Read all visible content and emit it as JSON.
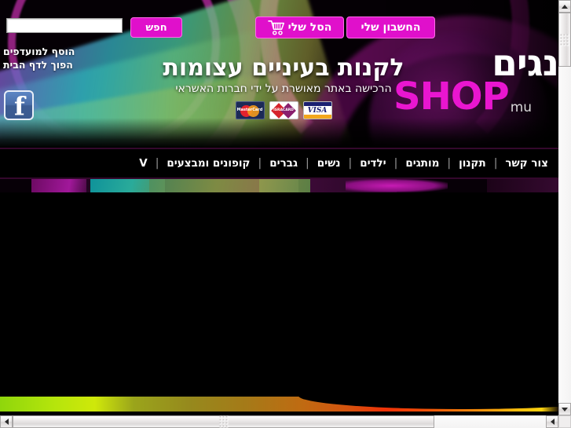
{
  "topbar": {
    "search_value": "",
    "search_placeholder": "",
    "search_button": "חפש",
    "cart_button": "הסל שלי",
    "account_button": "החשבון שלי",
    "cart_icon": "shopping-cart-icon"
  },
  "side_links": [
    {
      "label": "הוסף למועדפים"
    },
    {
      "label": "הפוך לדף הבית"
    }
  ],
  "social": {
    "facebook_glyph": "f",
    "facebook_icon": "facebook-icon"
  },
  "banner": {
    "headline": "לקנות בעיניים עצומות",
    "subline": "הרכישה באתר מאושרת על ידי חברות האשראי",
    "cards": [
      {
        "name": "mastercard-logo",
        "label": "MasterCard"
      },
      {
        "name": "isracard-logo",
        "label": "ISRACARD"
      },
      {
        "name": "visa-logo",
        "label": "VISA"
      }
    ]
  },
  "logo": {
    "top_text": "נגים",
    "shop_text": "SHOP",
    "suffix_text": "mu"
  },
  "nav": {
    "items": [
      {
        "label": "צור קשר"
      },
      {
        "label": "תקנון"
      },
      {
        "label": "מותגים"
      },
      {
        "label": "ילדים"
      },
      {
        "label": "נשים"
      },
      {
        "label": "גברים"
      },
      {
        "label": "קופונים ומבצעים"
      },
      {
        "label": "V"
      }
    ],
    "separator": "|"
  },
  "colors": {
    "accent_magenta": "#e010cb",
    "accent_magenta_border": "#ff6ae8",
    "logo_shop": "#e916d0",
    "nav_background": "#000000",
    "nav_border": "#33082c",
    "page_background": "#000000",
    "facebook_blue": "#4a6ea8"
  },
  "scrollbars": {
    "vertical": {
      "up_arrow": "▲",
      "down_arrow": "▼",
      "thumb_position_percent": 0
    },
    "horizontal": {
      "left_arrow": "◄",
      "right_arrow": "►",
      "thumb_position_percent": 0
    }
  }
}
